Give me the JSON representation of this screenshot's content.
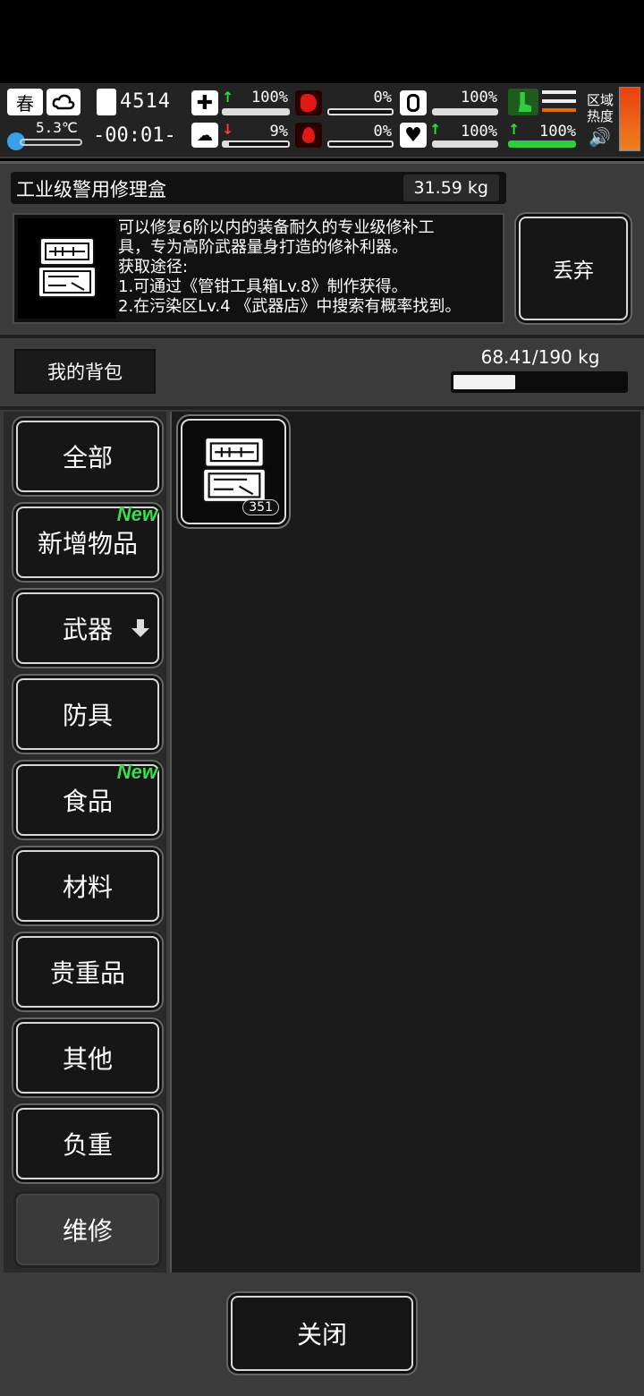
{
  "status": {
    "season": "春",
    "temperature": "5.3℃",
    "day_counter": "4514",
    "clock": "-00:01-",
    "health_pct": "100%",
    "brain_pct": "9%",
    "hunger_pct": "0%",
    "blood_pct": "0%",
    "water_pct": "100%",
    "heart_pct": "100%",
    "stamina_pct": "100%",
    "zone_heat_label": "区域热度",
    "colors": {
      "green": "#2ecc40",
      "red": "#ff3a3a",
      "heat": "#e86a10"
    },
    "icons": [
      "season-icon",
      "weather-icon",
      "thermometer-icon",
      "calendar-icon",
      "first-aid-icon",
      "brain-icon",
      "stomach-icon",
      "blood-drop-icon",
      "water-bottle-icon",
      "heart-icon",
      "running-icon",
      "sound-icon"
    ]
  },
  "item_detail": {
    "name": "工业级警用修理盒",
    "weight": "31.59 kg",
    "description_lines": [
      "可以修复6阶以内的装备耐久的专业级修补工",
      "具，专为高阶武器量身打造的修补利器。",
      "获取途径:",
      "1.可通过《管钳工具箱Lv.8》制作获得。",
      "2.在污染区Lv.4 《武器店》中搜索有概率找到。"
    ],
    "discard_label": "丢弃"
  },
  "backpack": {
    "title": "我的背包",
    "capacity_text": "68.41/190 kg",
    "capacity_fraction": 0.36
  },
  "categories": [
    {
      "label": "全部",
      "new": false
    },
    {
      "label": "新增物品",
      "new": true,
      "new_label": "New"
    },
    {
      "label": "武器",
      "new": false
    },
    {
      "label": "防具",
      "new": false
    },
    {
      "label": "食品",
      "new": true,
      "new_label": "New"
    },
    {
      "label": "材料",
      "new": false
    },
    {
      "label": "贵重品",
      "new": false
    },
    {
      "label": "其他",
      "new": false
    },
    {
      "label": "负重",
      "new": false
    },
    {
      "label": "维修",
      "new": false,
      "selected": true
    }
  ],
  "items": [
    {
      "icon": "toolbox-icon",
      "count": "351"
    }
  ],
  "close_label": "关闭"
}
